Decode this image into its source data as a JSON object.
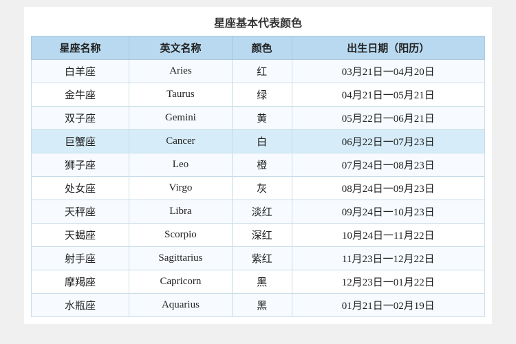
{
  "page": {
    "title": "星座基本代表颜色"
  },
  "table": {
    "headers": [
      "星座名称",
      "英文名称",
      "颜色",
      "出生日期（阳历）"
    ],
    "rows": [
      {
        "chinese": "白羊座",
        "english": "Aries",
        "color": "红",
        "date": "03月21日一04月20日",
        "highlight": false
      },
      {
        "chinese": "金牛座",
        "english": "Taurus",
        "color": "绿",
        "date": "04月21日一05月21日",
        "highlight": false
      },
      {
        "chinese": "双子座",
        "english": "Gemini",
        "color": "黄",
        "date": "05月22日一06月21日",
        "highlight": false
      },
      {
        "chinese": "巨蟹座",
        "english": "Cancer",
        "color": "白",
        "date": "06月22日一07月23日",
        "highlight": true
      },
      {
        "chinese": "狮子座",
        "english": "Leo",
        "color": "橙",
        "date": "07月24日一08月23日",
        "highlight": false
      },
      {
        "chinese": "处女座",
        "english": "Virgo",
        "color": "灰",
        "date": "08月24日一09月23日",
        "highlight": false
      },
      {
        "chinese": "天秤座",
        "english": "Libra",
        "color": "淡红",
        "date": "09月24日一10月23日",
        "highlight": false
      },
      {
        "chinese": "天蝎座",
        "english": "Scorpio",
        "color": "深红",
        "date": "10月24日一11月22日",
        "highlight": false
      },
      {
        "chinese": "射手座",
        "english": "Sagittarius",
        "color": "紫红",
        "date": "11月23日一12月22日",
        "highlight": false
      },
      {
        "chinese": "摩羯座",
        "english": "Capricorn",
        "color": "黑",
        "date": "12月23日一01月22日",
        "highlight": false
      },
      {
        "chinese": "水瓶座",
        "english": "Aquarius",
        "color": "黑",
        "date": "01月21日一02月19日",
        "highlight": false
      }
    ]
  }
}
